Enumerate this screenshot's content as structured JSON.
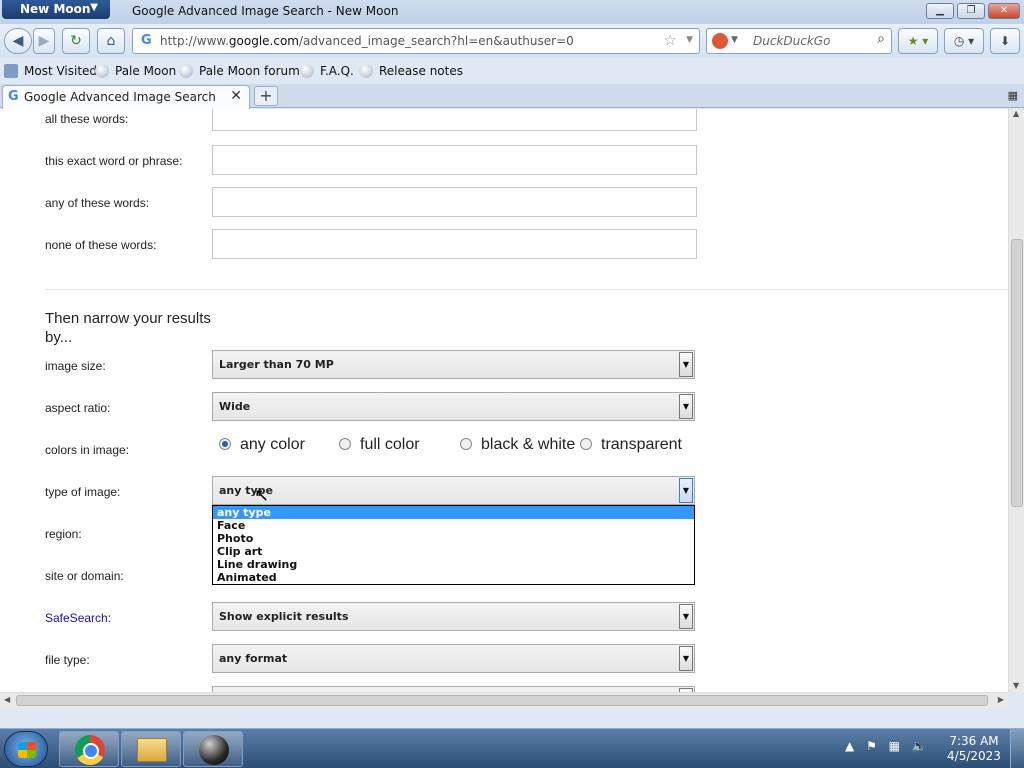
{
  "window": {
    "app_menu": "New Moon",
    "title": "Google Advanced Image Search - New Moon"
  },
  "nav": {
    "url_prefix": "http://www.",
    "url_domain": "google.com",
    "url_path": "/advanced_image_search?hl=en&authuser=0",
    "search_placeholder": "DuckDuckGo"
  },
  "bookmarks": [
    "Most Visited",
    "Pale Moon",
    "Pale Moon forum",
    "F.A.Q.",
    "Release notes"
  ],
  "tabs": [
    {
      "label": "Google Advanced Image Search"
    }
  ],
  "form": {
    "labels": {
      "all_words": "all these words:",
      "exact_phrase": "this exact word or phrase:",
      "any_words": "any of these words:",
      "none_words": "none of these words:",
      "narrow_heading": "Then narrow your results by...",
      "image_size": "image size:",
      "aspect_ratio": "aspect ratio:",
      "colors": "colors in image:",
      "type": "type of image:",
      "region": "region:",
      "site": "site or domain:",
      "safesearch": "SafeSearch",
      "safesearch_colon": ":",
      "file_type": "file type:"
    },
    "image_size_value": "Larger than 70 MP",
    "aspect_ratio_value": "Wide",
    "color_options": [
      "any color",
      "full color",
      "black & white",
      "transparent"
    ],
    "color_selected": "any color",
    "type_value": "any type",
    "type_options": [
      "any type",
      "Face",
      "Photo",
      "Clip art",
      "Line drawing",
      "Animated"
    ],
    "type_highlighted": "any type",
    "safesearch_value": "Show explicit results",
    "file_type_value": "any format"
  },
  "taskbar": {
    "time": "7:36 AM",
    "date": "4/5/2023"
  },
  "colors": {
    "highlight": "#3399ff",
    "link": "#1a0dab",
    "titlebar": "#bfd0e8"
  }
}
